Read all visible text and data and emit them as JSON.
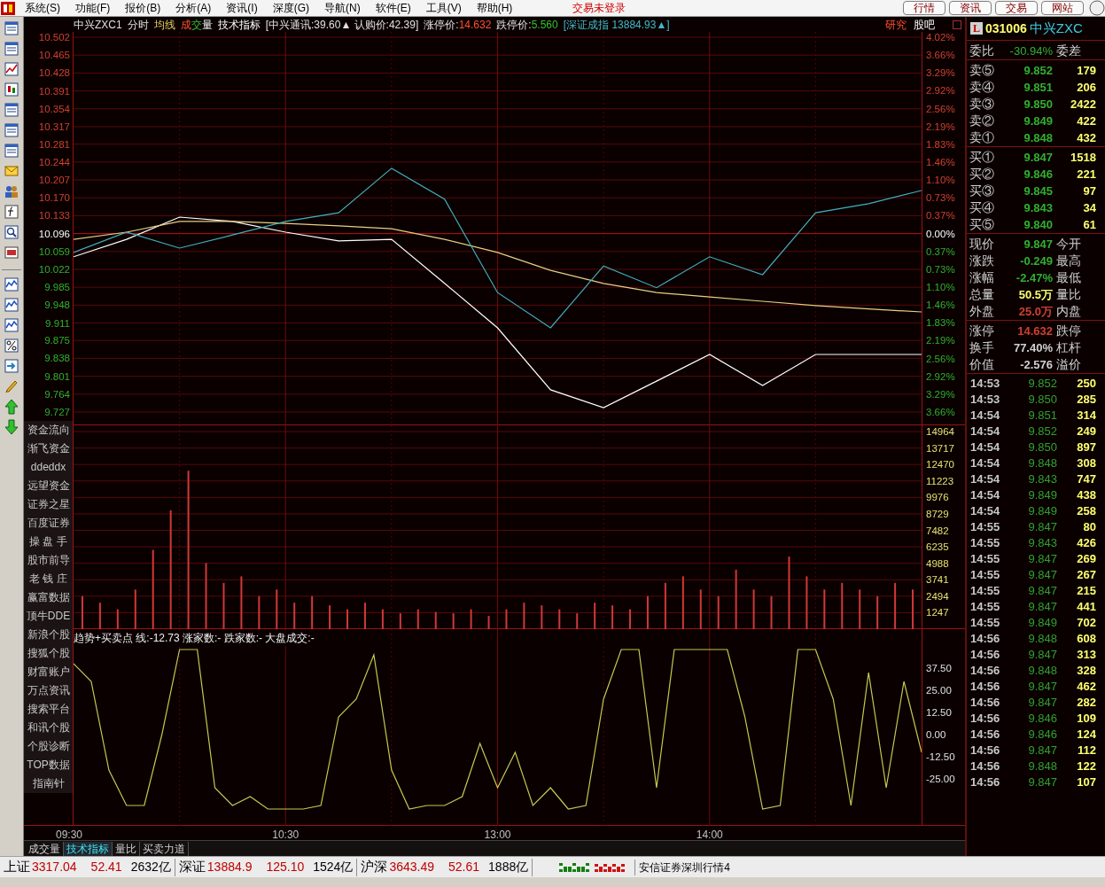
{
  "menu_bar": {
    "items": [
      "系统(S)",
      "功能(F)",
      "报价(B)",
      "分析(A)",
      "资讯(I)",
      "深度(G)",
      "导航(N)",
      "软件(E)",
      "工具(V)",
      "帮助(H)"
    ],
    "login_status": "交易未登录",
    "buttons": [
      "行情",
      "资讯",
      "交易",
      "网站"
    ]
  },
  "chart_header": {
    "segments": [
      {
        "text": "中兴ZXC1",
        "kind": "label"
      },
      {
        "text": "分时",
        "kind": "label"
      },
      {
        "text": "均线",
        "kind": "average"
      },
      {
        "text": "成",
        "kind": "up",
        "joined": true
      },
      {
        "text": "交",
        "kind": "down",
        "joined": true
      },
      {
        "text": "量",
        "kind": "bright"
      },
      {
        "text": "技术指标",
        "kind": "bright"
      },
      {
        "text": "[中兴通讯:39.60▲ 认购价:42.39]",
        "kind": "label"
      },
      {
        "text": "涨停价:",
        "kind": "label",
        "joined": true
      },
      {
        "text": "14.632",
        "kind": "up"
      },
      {
        "text": "跌停价:",
        "kind": "label",
        "joined": true
      },
      {
        "text": "5.560",
        "kind": "down"
      },
      {
        "text": "[深证成指 13884.93▲]",
        "kind": "index"
      }
    ],
    "links": [
      {
        "text": "研究",
        "kind": "up"
      },
      {
        "text": "股吧",
        "kind": "bright"
      }
    ]
  },
  "percent_labels": [
    "4.02%",
    "3.66%",
    "3.29%",
    "2.92%",
    "2.56%",
    "2.19%",
    "1.83%",
    "1.46%",
    "1.10%",
    "0.73%",
    "0.37%",
    "0.00%",
    "0.37%",
    "0.73%",
    "1.10%",
    "1.46%",
    "1.83%",
    "2.19%",
    "2.56%",
    "2.92%",
    "3.29%",
    "3.66%"
  ],
  "price_chart": {
    "chart_data": {
      "type": "line",
      "categories": [
        null,
        null,
        null,
        null,
        null,
        null,
        null,
        null,
        null,
        null,
        null,
        null,
        null,
        null,
        null,
        null,
        null
      ],
      "ylim": [
        9.6995,
        10.513
      ],
      "grid": true,
      "ref_lines": [
        {
          "axis": "y",
          "value": 10.096
        }
      ],
      "yticks": [
        {
          "value": 10.502,
          "label": "10.502"
        },
        {
          "value": 10.465,
          "label": "10.465"
        },
        {
          "value": 10.428,
          "label": "10.428"
        },
        {
          "value": 10.391,
          "label": "10.391"
        },
        {
          "value": 10.354,
          "label": "10.354"
        },
        {
          "value": 10.317,
          "label": "10.317"
        },
        {
          "value": 10.281,
          "label": "10.281"
        },
        {
          "value": 10.244,
          "label": "10.244"
        },
        {
          "value": 10.207,
          "label": "10.207"
        },
        {
          "value": 10.17,
          "label": "10.170"
        },
        {
          "value": 10.133,
          "label": "10.133"
        },
        {
          "value": 10.096,
          "label": "10.096"
        },
        {
          "value": 10.059,
          "label": "10.059"
        },
        {
          "value": 10.022,
          "label": "10.022"
        },
        {
          "value": 9.985,
          "label": "9.985"
        },
        {
          "value": 9.948,
          "label": "9.948"
        },
        {
          "value": 9.911,
          "label": "9.911"
        },
        {
          "value": 9.875,
          "label": "9.875"
        },
        {
          "value": 9.838,
          "label": "9.838"
        },
        {
          "value": 9.801,
          "label": "9.801"
        },
        {
          "value": 9.764,
          "label": "9.764"
        },
        {
          "value": 9.727,
          "label": "9.727"
        }
      ],
      "series": [
        {
          "color": "#ffffff",
          "values": [
            10.048,
            10.084,
            10.13,
            10.121,
            10.099,
            10.081,
            10.084,
            9.993,
            9.901,
            9.773,
            9.736,
            9.791,
            9.846,
            9.782,
            9.846,
            9.846,
            9.846
          ]
        },
        {
          "color": "#e8d080",
          "values": [
            10.084,
            10.099,
            10.121,
            10.121,
            10.117,
            10.112,
            10.106,
            10.084,
            10.057,
            10.02,
            9.993,
            9.974,
            9.965,
            9.956,
            9.947,
            9.94,
            9.934
          ]
        },
        {
          "color": "#40b0c0",
          "values": [
            10.057,
            10.099,
            10.066,
            10.093,
            10.121,
            10.139,
            10.231,
            10.167,
            9.974,
            9.901,
            10.029,
            9.984,
            10.048,
            10.011,
            10.139,
            10.158,
            10.185
          ]
        }
      ]
    }
  },
  "volume_chart": {
    "chart_data": {
      "type": "bar",
      "categories": [
        null,
        null,
        null,
        null,
        null,
        null,
        null,
        null,
        null,
        null,
        null,
        null,
        null,
        null,
        null,
        null,
        null,
        null,
        null,
        null,
        null,
        null,
        null,
        null,
        null,
        null,
        null,
        null,
        null,
        null,
        null,
        null,
        null,
        null,
        null,
        null,
        null,
        null,
        null,
        null,
        null,
        null,
        null,
        null,
        null,
        null,
        null,
        null
      ],
      "ylim": [
        0,
        15438
      ],
      "grid": true,
      "yticks": [
        14964,
        13717,
        12470,
        11223,
        9976,
        8729,
        7482,
        6235,
        4988,
        3741,
        2494,
        1247
      ],
      "series": [
        {
          "color": "#d03838",
          "values": [
            2500,
            2000,
            1500,
            3000,
            6000,
            9000,
            12000,
            5000,
            3500,
            4000,
            2500,
            3000,
            2000,
            2500,
            1800,
            1500,
            2000,
            1500,
            1200,
            1500,
            1300,
            1200,
            1500,
            1000,
            1500,
            2000,
            1800,
            1500,
            1200,
            2000,
            1800,
            1500,
            2500,
            3500,
            4000,
            3000,
            2500,
            4500,
            3000,
            2500,
            5500,
            4000,
            3000,
            3500,
            3000,
            2500,
            3500,
            3000
          ]
        }
      ]
    }
  },
  "indicator": {
    "title": "趋势+买卖点 线:-12.73 涨家数:- 跌家数:- 大盘成交:-",
    "chart_data": {
      "type": "line",
      "categories": [
        null,
        null,
        null,
        null,
        null,
        null,
        null,
        null,
        null,
        null,
        null,
        null,
        null,
        null,
        null,
        null,
        null,
        null,
        null,
        null,
        null,
        null,
        null,
        null,
        null,
        null,
        null,
        null,
        null,
        null,
        null,
        null,
        null,
        null,
        null,
        null,
        null,
        null,
        null,
        null,
        null,
        null,
        null,
        null,
        null,
        null,
        null,
        null,
        null
      ],
      "ylim": [
        -51.5,
        59.5
      ],
      "grid": true,
      "yticks": [
        {
          "value": 37.5,
          "label": "37.50"
        },
        {
          "value": 25,
          "label": "25.00"
        },
        {
          "value": 12.5,
          "label": "12.50"
        },
        {
          "value": 0,
          "label": "0.00"
        },
        {
          "value": -12.5,
          "label": "-12.50"
        },
        {
          "value": -25,
          "label": "-25.00"
        }
      ],
      "series": [
        {
          "color": "#c8c850",
          "values": [
            40,
            30,
            -20,
            -40,
            -40,
            0,
            48,
            48,
            -30,
            -40,
            -35,
            -42,
            -42,
            -42,
            -40,
            10,
            20,
            45,
            -20,
            -42,
            -40,
            -40,
            -35,
            -5,
            -30,
            -10,
            -40,
            -30,
            -42,
            -40,
            20,
            48,
            48,
            -30,
            48,
            48,
            48,
            48,
            10,
            -42,
            -40,
            48,
            48,
            20,
            -40,
            35,
            -30,
            30,
            -10
          ]
        }
      ]
    }
  },
  "time_axis": [
    "09:30",
    "10:30",
    "13:00",
    "14:00"
  ],
  "side_menu": [
    "资金流向",
    "渐飞资金",
    "ddeddx",
    "远望资金",
    "证券之星",
    "百度证券",
    "操 盘 手",
    "股市前导",
    "老 钱 庄",
    "赢富数据",
    "顶牛DDE",
    "新浪个股",
    "搜狐个股",
    "财富账户",
    "万点资讯",
    "搜索平台",
    "和讯个股",
    "个股诊断",
    "TOP数据",
    "指南针"
  ],
  "bottom_tabs": [
    {
      "label": "成交量",
      "selected": false
    },
    {
      "label": "技术指标",
      "selected": true
    },
    {
      "label": "量比",
      "selected": false
    },
    {
      "label": "买卖力道",
      "selected": false
    }
  ],
  "quote_panel": {
    "badge": "L",
    "code": "031006",
    "name": "中兴ZXC",
    "ratio": {
      "label": "委比",
      "value": "-30.94%",
      "label2": "委差"
    },
    "sell_levels": [
      {
        "label": "卖⑤",
        "price": "9.852",
        "volume": "179"
      },
      {
        "label": "卖④",
        "price": "9.851",
        "volume": "206"
      },
      {
        "label": "卖③",
        "price": "9.850",
        "volume": "2422"
      },
      {
        "label": "卖②",
        "price": "9.849",
        "volume": "422"
      },
      {
        "label": "卖①",
        "price": "9.848",
        "volume": "432"
      }
    ],
    "buy_levels": [
      {
        "label": "买①",
        "price": "9.847",
        "volume": "1518"
      },
      {
        "label": "买②",
        "price": "9.846",
        "volume": "221"
      },
      {
        "label": "买③",
        "price": "9.845",
        "volume": "97"
      },
      {
        "label": "买④",
        "price": "9.843",
        "volume": "34"
      },
      {
        "label": "买⑤",
        "price": "9.840",
        "volume": "61"
      }
    ],
    "stats": [
      {
        "label": "现价",
        "value": "9.847",
        "color": "#30b030",
        "label2": "今开"
      },
      {
        "label": "涨跌",
        "value": "-0.249",
        "color": "#30b030",
        "label2": "最高"
      },
      {
        "label": "涨幅",
        "value": "-2.47%",
        "color": "#30b030",
        "label2": "最低"
      },
      {
        "label": "总量",
        "value": "50.5万",
        "color": "#ffff70",
        "label2": "量比"
      },
      {
        "label": "外盘",
        "value": "25.0万",
        "color": "#d04030",
        "label2": "内盘"
      }
    ],
    "limits": [
      {
        "label": "涨停",
        "value": "14.632",
        "color": "#d04030",
        "label2": "跌停"
      },
      {
        "label": "换手",
        "value": "77.40%",
        "color": "#d0d0d0",
        "label2": "杠杆"
      },
      {
        "label": "价值",
        "value": "-2.576",
        "color": "#d0d0d0",
        "label2": "溢价"
      }
    ],
    "ticks": [
      {
        "time": "14:53",
        "price": "9.852",
        "volume": "250"
      },
      {
        "time": "14:53",
        "price": "9.850",
        "volume": "285"
      },
      {
        "time": "14:54",
        "price": "9.851",
        "volume": "314"
      },
      {
        "time": "14:54",
        "price": "9.852",
        "volume": "249"
      },
      {
        "time": "14:54",
        "price": "9.850",
        "volume": "897"
      },
      {
        "time": "14:54",
        "price": "9.848",
        "volume": "308"
      },
      {
        "time": "14:54",
        "price": "9.843",
        "volume": "747"
      },
      {
        "time": "14:54",
        "price": "9.849",
        "volume": "438"
      },
      {
        "time": "14:54",
        "price": "9.849",
        "volume": "258"
      },
      {
        "time": "14:55",
        "price": "9.847",
        "volume": "80"
      },
      {
        "time": "14:55",
        "price": "9.843",
        "volume": "426"
      },
      {
        "time": "14:55",
        "price": "9.847",
        "volume": "269"
      },
      {
        "time": "14:55",
        "price": "9.847",
        "volume": "267"
      },
      {
        "time": "14:55",
        "price": "9.847",
        "volume": "215"
      },
      {
        "time": "14:55",
        "price": "9.847",
        "volume": "441"
      },
      {
        "time": "14:55",
        "price": "9.849",
        "volume": "702"
      },
      {
        "time": "14:56",
        "price": "9.848",
        "volume": "608"
      },
      {
        "time": "14:56",
        "price": "9.847",
        "volume": "313"
      },
      {
        "time": "14:56",
        "price": "9.848",
        "volume": "328"
      },
      {
        "time": "14:56",
        "price": "9.847",
        "volume": "462"
      },
      {
        "time": "14:56",
        "price": "9.847",
        "volume": "282"
      },
      {
        "time": "14:56",
        "price": "9.846",
        "volume": "109"
      },
      {
        "time": "14:56",
        "price": "9.846",
        "volume": "124"
      },
      {
        "time": "14:56",
        "price": "9.847",
        "volume": "112"
      },
      {
        "time": "14:56",
        "price": "9.848",
        "volume": "122"
      },
      {
        "time": "14:56",
        "price": "9.847",
        "volume": "107"
      }
    ]
  },
  "status_bar": {
    "indices": [
      {
        "name": "上证",
        "value": "3317.04",
        "change": "52.41",
        "amount": "2632亿"
      },
      {
        "name": "深证",
        "value": "13884.9",
        "change": "125.10",
        "amount": "1524亿"
      },
      {
        "name": "沪深",
        "value": "3643.49",
        "change": "52.61",
        "amount": "1888亿"
      }
    ],
    "server": "安信证券深圳行情4"
  }
}
